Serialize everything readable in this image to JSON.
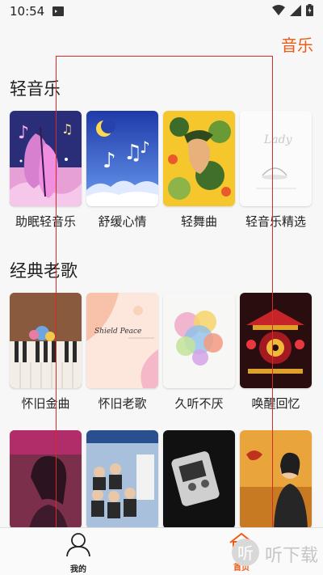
{
  "status_bar": {
    "time": "10:54"
  },
  "header": {
    "title": "音乐"
  },
  "sections": [
    {
      "title": "轻音乐",
      "items": [
        {
          "label": "助眠轻音乐"
        },
        {
          "label": "舒缓心情"
        },
        {
          "label": "轻舞曲"
        },
        {
          "label": "轻音乐精选"
        }
      ]
    },
    {
      "title": "经典老歌",
      "items": [
        {
          "label": "怀旧金曲"
        },
        {
          "label": "怀旧老歌"
        },
        {
          "label": "久听不厌"
        },
        {
          "label": "唤醒回忆"
        }
      ]
    }
  ],
  "bottom_nav": {
    "items": [
      {
        "label": "我的"
      },
      {
        "label": "首页"
      }
    ]
  },
  "watermark": {
    "text": "听下载"
  },
  "colors": {
    "accent": "#f05a14"
  }
}
